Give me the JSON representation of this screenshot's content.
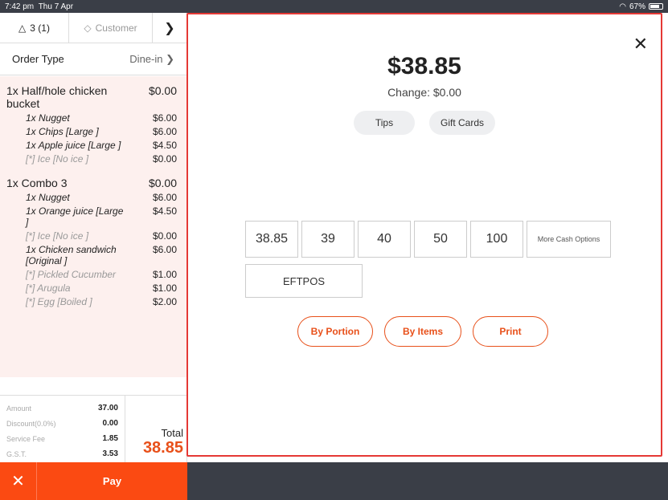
{
  "status_bar": {
    "time": "7:42 pm",
    "date": "Thu 7 Apr",
    "battery": "67%",
    "battery_level": 0.67
  },
  "order_panel": {
    "guests": "3 (1)",
    "customer_label": "Customer",
    "order_type_label": "Order Type",
    "order_type_value": "Dine-in",
    "items": [
      {
        "name": "1x Half/hole chicken bucket",
        "price": "$0.00",
        "subs": [
          {
            "kind": "sub",
            "name": "1x Nugget",
            "price": "$6.00"
          },
          {
            "kind": "sub",
            "name": "1x Chips   [Large ]",
            "price": "$6.00"
          },
          {
            "kind": "sub",
            "name": "1x Apple juice [Large ]",
            "price": "$4.50"
          },
          {
            "kind": "mod",
            "name": "[*] Ice  [No ice ]",
            "price": "$0.00"
          }
        ]
      },
      {
        "name": "1x Combo 3",
        "price": "$0.00",
        "subs": [
          {
            "kind": "sub",
            "name": "1x Nugget",
            "price": "$6.00"
          },
          {
            "kind": "sub",
            "name": "1x Orange juice [Large ]",
            "price": "$4.50"
          },
          {
            "kind": "mod",
            "name": "[*] Ice  [No ice ]",
            "price": "$0.00"
          },
          {
            "kind": "sub",
            "name": "1x Chicken sandwich [Original ]",
            "price": "$6.00"
          },
          {
            "kind": "mod",
            "name": "[*] Pickled Cucumber",
            "price": "$1.00"
          },
          {
            "kind": "mod",
            "name": "[*] Arugula",
            "price": "$1.00"
          },
          {
            "kind": "mod",
            "name": "[*] Egg  [Boiled ]",
            "price": "$2.00"
          }
        ]
      }
    ],
    "totals": [
      {
        "label": "Amount",
        "value": "37.00"
      },
      {
        "label": "Discount(0.0%)",
        "value": "0.00"
      },
      {
        "label": "Service Fee",
        "value": "1.85"
      },
      {
        "label": "G.S.T.",
        "value": "3.53"
      }
    ],
    "total_label": "Total",
    "total_value": "38.85",
    "pay_label": "Pay"
  },
  "payment": {
    "amount": "$38.85",
    "change": "Change: $0.00",
    "tips_label": "Tips",
    "gift_cards_label": "Gift Cards",
    "cash_options": [
      "38.85",
      "39",
      "40",
      "50",
      "100"
    ],
    "more_cash_label": "More Cash Options",
    "eftpos_label": "EFTPOS",
    "by_portion_label": "By Portion",
    "by_items_label": "By Items",
    "print_label": "Print"
  },
  "colors": {
    "accent": "#fb4a12",
    "modal_border": "#e53935",
    "items_bg": "#fdf0ee"
  }
}
